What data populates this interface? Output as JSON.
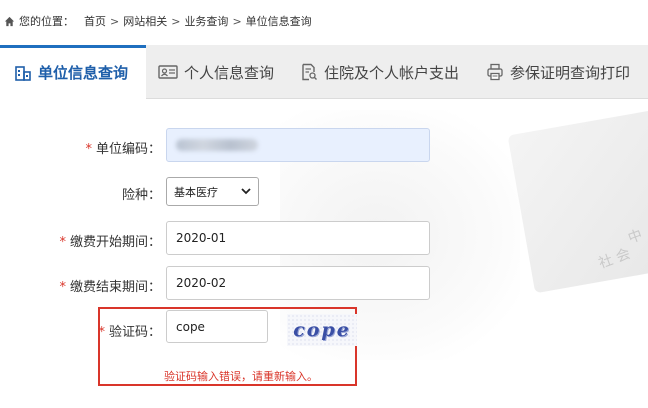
{
  "breadcrumb": {
    "prefix": "您的位置：",
    "items": [
      "首页",
      "网站相关",
      "业务查询",
      "单位信息查询"
    ],
    "separator": ">"
  },
  "tabs": [
    {
      "label": "单位信息查询",
      "icon": "building-icon",
      "active": true
    },
    {
      "label": "个人信息查询",
      "icon": "id-card-icon",
      "active": false
    },
    {
      "label": "住院及个人帐户支出",
      "icon": "document-search-icon",
      "active": false
    },
    {
      "label": "参保证明查询打印",
      "icon": "printer-icon",
      "active": false
    }
  ],
  "form": {
    "unit_code": {
      "label": "单位编码",
      "value": ""
    },
    "insurance_type": {
      "label": "险种",
      "selected": "基本医疗"
    },
    "start_period": {
      "label": "缴费开始期间",
      "value": "2020-01"
    },
    "end_period": {
      "label": "缴费结束期间",
      "value": "2020-02"
    },
    "captcha": {
      "label": "验证码",
      "value": "cope",
      "image_text": "cope",
      "error": "验证码输入错误，请重新输入。"
    },
    "required_mark": "*",
    "colon": "："
  },
  "background": {
    "text1": "中",
    "text2": "社 会"
  },
  "colors": {
    "accent": "#1f6fbf",
    "error": "#d9352a",
    "tab_bg": "#eeeeee"
  }
}
